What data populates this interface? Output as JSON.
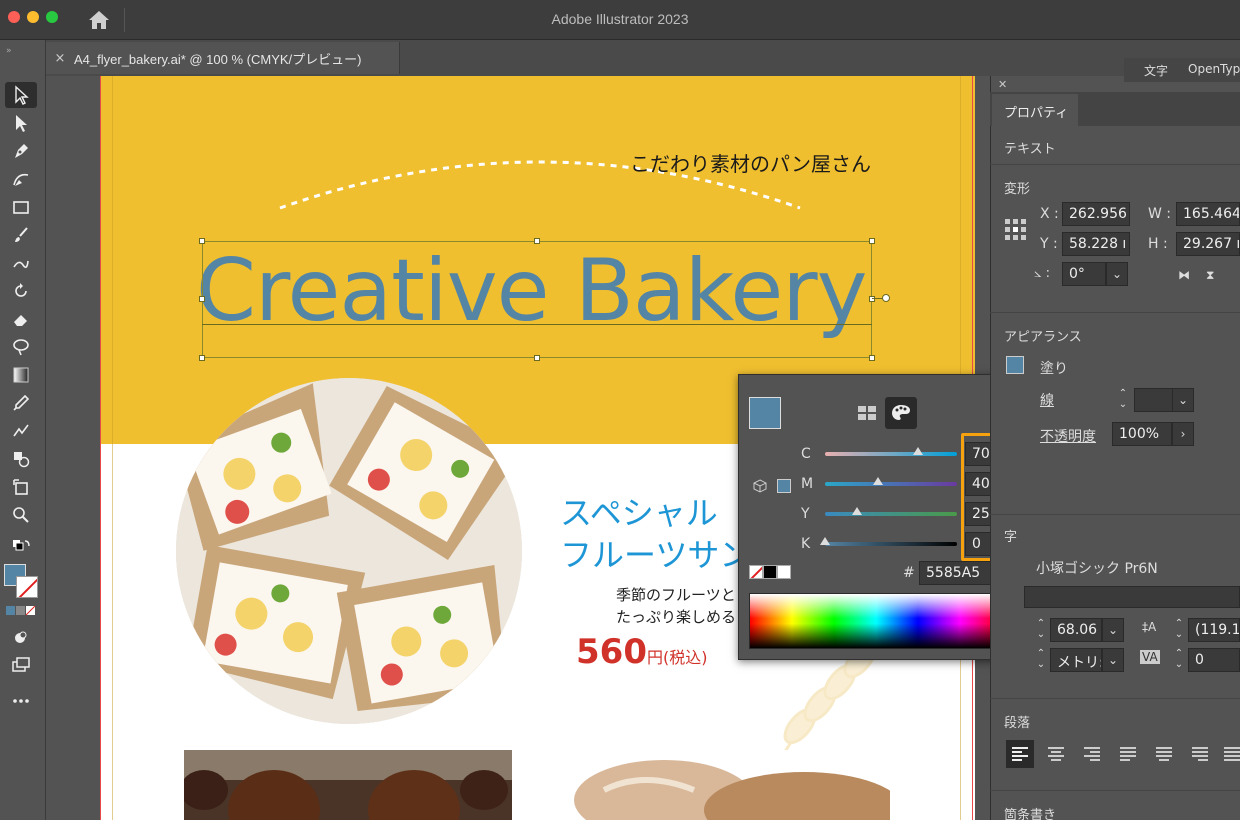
{
  "app": {
    "title": "Adobe Illustrator 2023"
  },
  "document": {
    "tab_label": "A4_flyer_bakery.ai* @ 100 % (CMYK/プレビュー)",
    "close": "×"
  },
  "artboard": {
    "tagline": "こだわり素材のパン屋さん",
    "headline": "Creative Bakery",
    "product_title_line1": "スペシャル",
    "product_title_line2": "フルーツサン",
    "product_desc_line1": "季節のフルーツと",
    "product_desc_line2": "たっぷり楽しめる",
    "price_num": "560",
    "price_unit": "円(税込)"
  },
  "color_panel": {
    "swatch_color": "#5585a5",
    "sliders": [
      {
        "letter": "C",
        "value": "70",
        "unit": "%"
      },
      {
        "letter": "M",
        "value": "40",
        "unit": "%"
      },
      {
        "letter": "Y",
        "value": "25",
        "unit": "%"
      },
      {
        "letter": "K",
        "value": "0",
        "unit": "%"
      }
    ],
    "hash": "#",
    "hex": "5585A5",
    "highlight_color": "#f6a20e"
  },
  "right_tabs": {
    "char": "文字",
    "opentype": "OpenTyp"
  },
  "properties": {
    "tab": "プロパティ",
    "context": "テキスト",
    "transform_title": "変形",
    "x_label": "X :",
    "x_value": "262.956",
    "w_label": "W :",
    "w_value": "165.464",
    "y_label": "Y :",
    "y_value": "58.228 ı",
    "h_label": "H :",
    "h_value": "29.267 ı",
    "angle_value": "0°",
    "appearance_title": "アピアランス",
    "fill_label": "塗り",
    "stroke_label": "線",
    "opacity_label": "不透明度",
    "opacity_value": "100%",
    "font_name": "小塚ゴシック Pr6N",
    "font_size": "68.06",
    "leading": "(119.1",
    "kerning": "メトリ:",
    "tracking": "0",
    "paragraph_title": "段落",
    "bullets_title": "箇条書き",
    "char_partial": "字"
  }
}
